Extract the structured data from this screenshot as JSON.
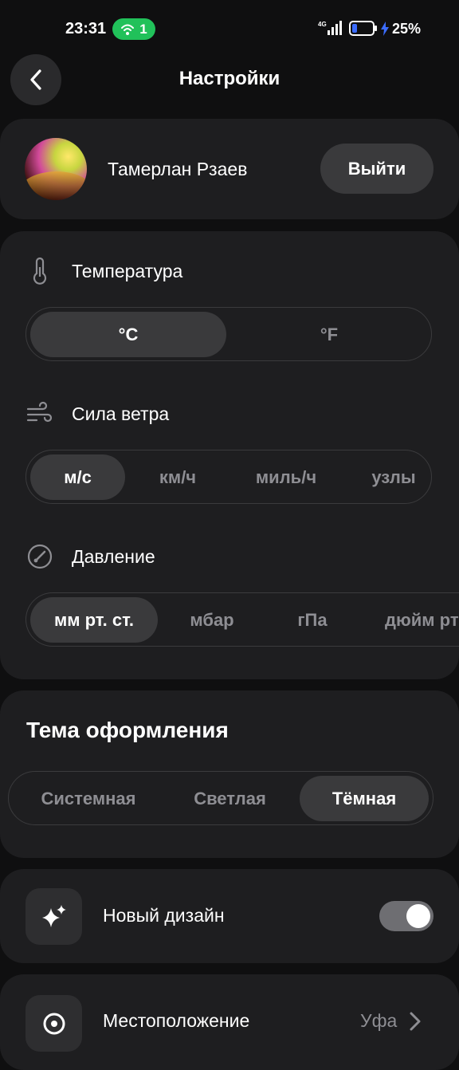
{
  "status_bar": {
    "time": "23:31",
    "hotspot_count": "1",
    "battery_percent": "25%",
    "battery_level": 0.25,
    "colors": {
      "hotspot": "#21c15a",
      "charging": "#3b6cff"
    }
  },
  "header": {
    "title": "Настройки",
    "back_icon": "chevron-left-icon"
  },
  "profile": {
    "name": "Тамерлан Рзаев",
    "logout_label": "Выйти"
  },
  "units": {
    "temperature": {
      "label": "Температура",
      "icon": "thermometer-icon",
      "options": [
        "°C",
        "°F"
      ],
      "selected": "°C"
    },
    "wind": {
      "label": "Сила ветра",
      "icon": "wind-icon",
      "options": [
        "м/с",
        "км/ч",
        "миль/ч",
        "узлы"
      ],
      "selected": "м/с"
    },
    "pressure": {
      "label": "Давление",
      "icon": "gauge-icon",
      "options": [
        "мм рт. ст.",
        "мбар",
        "гПа",
        "дюйм рт"
      ],
      "selected": "мм рт. ст."
    }
  },
  "theme": {
    "title": "Тема оформления",
    "options": [
      "Системная",
      "Светлая",
      "Тёмная"
    ],
    "selected": "Тёмная"
  },
  "new_design": {
    "label": "Новый дизайн",
    "icon": "sparkles-icon",
    "enabled": true
  },
  "location": {
    "label": "Местоположение",
    "value": "Уфа",
    "icon": "location-pin-icon"
  }
}
